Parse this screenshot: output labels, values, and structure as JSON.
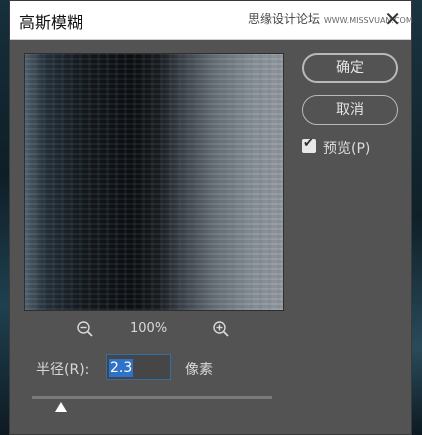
{
  "dialog": {
    "title": "高斯模糊",
    "watermark": "思缘设计论坛",
    "watermark_site": "WWW.MISSVUAN.COM",
    "close_glyph": "✕"
  },
  "buttons": {
    "ok_label": "确定",
    "cancel_label": "取消"
  },
  "preview_option": {
    "label": "预览(P)",
    "checked": true
  },
  "zoom": {
    "level": "100%",
    "zoom_out_icon": "zoom-out-icon",
    "zoom_in_icon": "zoom-in-icon"
  },
  "radius": {
    "label": "半径(R):",
    "value": "2.3",
    "unit": "像素",
    "slider_fraction": 0.12
  },
  "colors": {
    "dialog_bg": "#535353",
    "selection": "#2f73c8",
    "titlebar": "#ffffff"
  }
}
